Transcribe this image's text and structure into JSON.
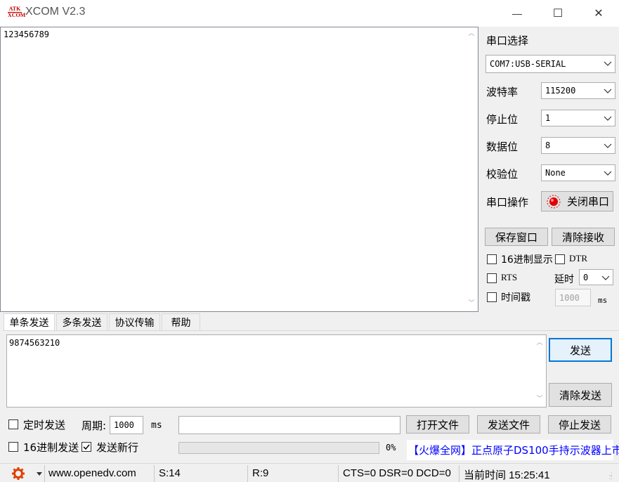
{
  "window": {
    "logo_text": "ATK XCOM",
    "title": "XCOM V2.3",
    "minimize_glyph": "—",
    "maximize_glyph": "☐",
    "close_glyph": "✕"
  },
  "receive": {
    "text": "123456789"
  },
  "serial": {
    "section_title": "串口选择",
    "port_value": "COM7:USB-SERIAL",
    "baud_label": "波特率",
    "baud_value": "115200",
    "stopbits_label": "停止位",
    "stopbits_value": "1",
    "databits_label": "数据位",
    "databits_value": "8",
    "parity_label": "校验位",
    "parity_value": "None",
    "operation_label": "串口操作",
    "operation_button": "关闭串口",
    "save_window_button": "保存窗口",
    "clear_receive_button": "清除接收",
    "hex_display_label": "16进制显示",
    "dtr_label": "DTR",
    "rts_label": "RTS",
    "delay_label": "延时",
    "delay_value": "0",
    "timestamp_label": "时间戳",
    "timestamp_value": "1000",
    "timestamp_unit": "ms"
  },
  "tabs": [
    "单条发送",
    "多条发送",
    "协议传输",
    "帮助"
  ],
  "send": {
    "text": "9874563210",
    "send_button": "发送",
    "clear_send_button": "清除发送",
    "timed_send_label": "定时发送",
    "period_label": "周期:",
    "period_value": "1000",
    "period_unit": "ms",
    "open_file_button": "打开文件",
    "send_file_button": "发送文件",
    "stop_send_button": "停止发送",
    "hex_send_label": "16进制发送",
    "newline_label": "发送新行",
    "progress_percent": "0%",
    "ad_text": "【火爆全网】正点原子DS100手持示波器上市"
  },
  "statusbar": {
    "website": "www.openedv.com",
    "sent": "S:14",
    "received": "R:9",
    "signals": "CTS=0 DSR=0 DCD=0",
    "time": "当前时间 15:25:41"
  },
  "colors": {
    "link_blue": "#0000ff",
    "accent_red": "#e00000",
    "send_button_border": "#0078d7"
  }
}
